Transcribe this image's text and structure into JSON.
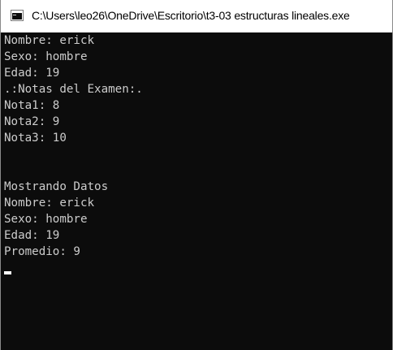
{
  "window": {
    "title": "C:\\Users\\leo26\\OneDrive\\Escritorio\\t3-03 estructuras lineales.exe",
    "icon": "console-app-icon"
  },
  "console": {
    "lines": [
      "Nombre: erick",
      "Sexo: hombre",
      "Edad: 19",
      ".:Notas del Examen:.",
      "Nota1: 8",
      "Nota2: 9",
      "Nota3: 10",
      "",
      "",
      "Mostrando Datos",
      "Nombre: erick",
      "Sexo: hombre",
      "Edad: 19",
      "Promedio: 9"
    ]
  },
  "colors": {
    "console_bg": "#0c0c0c",
    "console_text": "#cccccc",
    "cursor": "#ffffff"
  }
}
